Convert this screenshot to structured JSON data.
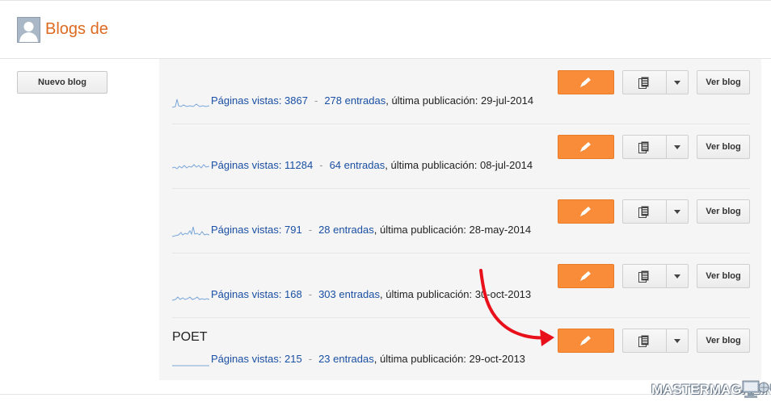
{
  "header": {
    "title": "Blogs de"
  },
  "sidebar": {
    "new_blog_label": "Nuevo blog"
  },
  "blogs": [
    {
      "name": "",
      "pageviews_label": "Páginas vistas: 3867",
      "posts_label": "278 entradas",
      "last_post_label": ", última publicación: 29-jul-2014",
      "view_label": "Ver blog"
    },
    {
      "name": "",
      "pageviews_label": "Páginas vistas: 11284",
      "posts_label": "64 entradas",
      "last_post_label": ", última publicación: 08-jul-2014",
      "view_label": "Ver blog"
    },
    {
      "name": "",
      "pageviews_label": "Páginas vistas: 791",
      "posts_label": "28 entradas",
      "last_post_label": ", última publicación: 28-may-2014",
      "view_label": "Ver blog"
    },
    {
      "name": "",
      "pageviews_label": "Páginas vistas: 168",
      "posts_label": "303 entradas",
      "last_post_label": ", última publicación: 30-oct-2013",
      "view_label": "Ver blog"
    },
    {
      "name": "POET",
      "pageviews_label": "Páginas vistas: 215",
      "posts_label": "23 entradas",
      "last_post_label": ", última publicación: 29-oct-2013",
      "view_label": "Ver blog"
    }
  ],
  "separator": "-",
  "watermark": "MASTERMAGAZINE",
  "colors": {
    "accent": "#dd6a20",
    "edit_button": "#f98c39",
    "link": "#1a4fa3",
    "annotation_arrow": "#e8101a"
  },
  "icons": {
    "edit": "pencil-icon",
    "posts": "posts-list-icon",
    "dropdown": "caret-down-icon"
  }
}
